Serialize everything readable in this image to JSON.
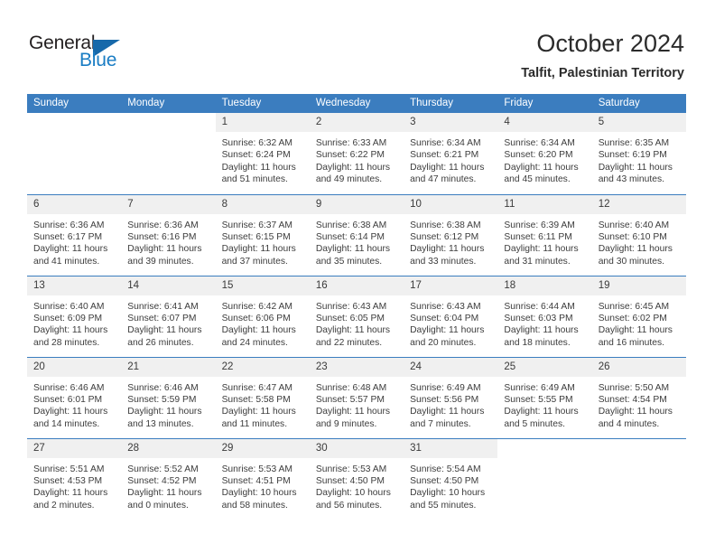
{
  "brand": {
    "name_part1": "General",
    "name_part2": "Blue",
    "triangle_icon": "triangle-icon",
    "accent_color": "#1a7dc4"
  },
  "header": {
    "title": "October 2024",
    "location": "Talfit, Palestinian Territory"
  },
  "calendar": {
    "header_bg": "#3b7dbf",
    "daynum_bg": "#f0f0f0",
    "weekday_headers": [
      "Sunday",
      "Monday",
      "Tuesday",
      "Wednesday",
      "Thursday",
      "Friday",
      "Saturday"
    ],
    "weeks": [
      [
        {
          "day": "",
          "lines": ""
        },
        {
          "day": "",
          "lines": ""
        },
        {
          "day": "1",
          "lines": "Sunrise: 6:32 AM\nSunset: 6:24 PM\nDaylight: 11 hours\nand 51 minutes."
        },
        {
          "day": "2",
          "lines": "Sunrise: 6:33 AM\nSunset: 6:22 PM\nDaylight: 11 hours\nand 49 minutes."
        },
        {
          "day": "3",
          "lines": "Sunrise: 6:34 AM\nSunset: 6:21 PM\nDaylight: 11 hours\nand 47 minutes."
        },
        {
          "day": "4",
          "lines": "Sunrise: 6:34 AM\nSunset: 6:20 PM\nDaylight: 11 hours\nand 45 minutes."
        },
        {
          "day": "5",
          "lines": "Sunrise: 6:35 AM\nSunset: 6:19 PM\nDaylight: 11 hours\nand 43 minutes."
        }
      ],
      [
        {
          "day": "6",
          "lines": "Sunrise: 6:36 AM\nSunset: 6:17 PM\nDaylight: 11 hours\nand 41 minutes."
        },
        {
          "day": "7",
          "lines": "Sunrise: 6:36 AM\nSunset: 6:16 PM\nDaylight: 11 hours\nand 39 minutes."
        },
        {
          "day": "8",
          "lines": "Sunrise: 6:37 AM\nSunset: 6:15 PM\nDaylight: 11 hours\nand 37 minutes."
        },
        {
          "day": "9",
          "lines": "Sunrise: 6:38 AM\nSunset: 6:14 PM\nDaylight: 11 hours\nand 35 minutes."
        },
        {
          "day": "10",
          "lines": "Sunrise: 6:38 AM\nSunset: 6:12 PM\nDaylight: 11 hours\nand 33 minutes."
        },
        {
          "day": "11",
          "lines": "Sunrise: 6:39 AM\nSunset: 6:11 PM\nDaylight: 11 hours\nand 31 minutes."
        },
        {
          "day": "12",
          "lines": "Sunrise: 6:40 AM\nSunset: 6:10 PM\nDaylight: 11 hours\nand 30 minutes."
        }
      ],
      [
        {
          "day": "13",
          "lines": "Sunrise: 6:40 AM\nSunset: 6:09 PM\nDaylight: 11 hours\nand 28 minutes."
        },
        {
          "day": "14",
          "lines": "Sunrise: 6:41 AM\nSunset: 6:07 PM\nDaylight: 11 hours\nand 26 minutes."
        },
        {
          "day": "15",
          "lines": "Sunrise: 6:42 AM\nSunset: 6:06 PM\nDaylight: 11 hours\nand 24 minutes."
        },
        {
          "day": "16",
          "lines": "Sunrise: 6:43 AM\nSunset: 6:05 PM\nDaylight: 11 hours\nand 22 minutes."
        },
        {
          "day": "17",
          "lines": "Sunrise: 6:43 AM\nSunset: 6:04 PM\nDaylight: 11 hours\nand 20 minutes."
        },
        {
          "day": "18",
          "lines": "Sunrise: 6:44 AM\nSunset: 6:03 PM\nDaylight: 11 hours\nand 18 minutes."
        },
        {
          "day": "19",
          "lines": "Sunrise: 6:45 AM\nSunset: 6:02 PM\nDaylight: 11 hours\nand 16 minutes."
        }
      ],
      [
        {
          "day": "20",
          "lines": "Sunrise: 6:46 AM\nSunset: 6:01 PM\nDaylight: 11 hours\nand 14 minutes."
        },
        {
          "day": "21",
          "lines": "Sunrise: 6:46 AM\nSunset: 5:59 PM\nDaylight: 11 hours\nand 13 minutes."
        },
        {
          "day": "22",
          "lines": "Sunrise: 6:47 AM\nSunset: 5:58 PM\nDaylight: 11 hours\nand 11 minutes."
        },
        {
          "day": "23",
          "lines": "Sunrise: 6:48 AM\nSunset: 5:57 PM\nDaylight: 11 hours\nand 9 minutes."
        },
        {
          "day": "24",
          "lines": "Sunrise: 6:49 AM\nSunset: 5:56 PM\nDaylight: 11 hours\nand 7 minutes."
        },
        {
          "day": "25",
          "lines": "Sunrise: 6:49 AM\nSunset: 5:55 PM\nDaylight: 11 hours\nand 5 minutes."
        },
        {
          "day": "26",
          "lines": "Sunrise: 5:50 AM\nSunset: 4:54 PM\nDaylight: 11 hours\nand 4 minutes."
        }
      ],
      [
        {
          "day": "27",
          "lines": "Sunrise: 5:51 AM\nSunset: 4:53 PM\nDaylight: 11 hours\nand 2 minutes."
        },
        {
          "day": "28",
          "lines": "Sunrise: 5:52 AM\nSunset: 4:52 PM\nDaylight: 11 hours\nand 0 minutes."
        },
        {
          "day": "29",
          "lines": "Sunrise: 5:53 AM\nSunset: 4:51 PM\nDaylight: 10 hours\nand 58 minutes."
        },
        {
          "day": "30",
          "lines": "Sunrise: 5:53 AM\nSunset: 4:50 PM\nDaylight: 10 hours\nand 56 minutes."
        },
        {
          "day": "31",
          "lines": "Sunrise: 5:54 AM\nSunset: 4:50 PM\nDaylight: 10 hours\nand 55 minutes."
        },
        {
          "day": "",
          "lines": ""
        },
        {
          "day": "",
          "lines": ""
        }
      ]
    ]
  }
}
